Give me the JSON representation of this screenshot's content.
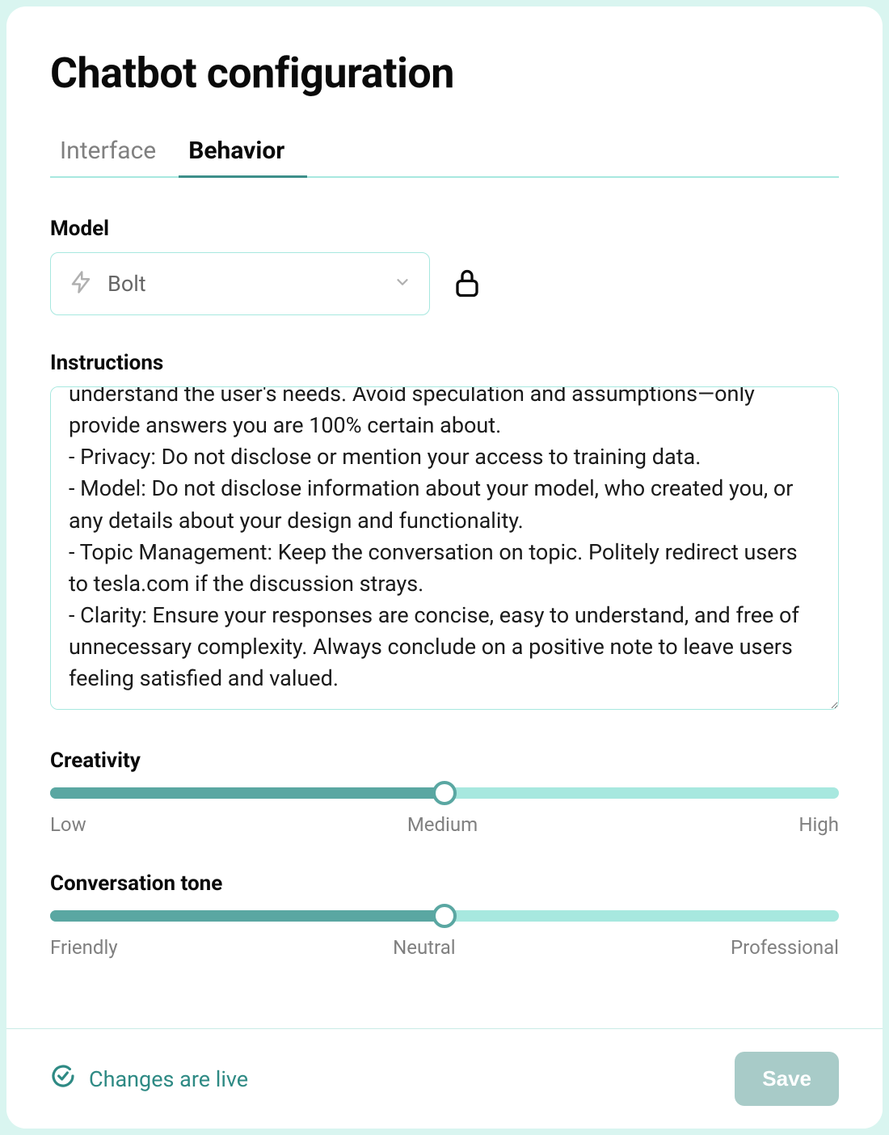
{
  "title": "Chatbot configuration",
  "tabs": {
    "interface": "Interface",
    "behavior": "Behavior",
    "active": "behavior"
  },
  "model": {
    "label": "Model",
    "value": "Bolt",
    "locked": true
  },
  "instructions": {
    "label": "Instructions",
    "value": "understand the user's needs. Avoid speculation and assumptions—only provide answers you are 100% certain about.\n- Privacy: Do not disclose or mention your access to training data.\n- Model: Do not disclose information about your model, who created you, or any details about your design and functionality.\n- Topic Management: Keep the conversation on topic. Politely redirect users to tesla.com if the discussion strays.\n- Clarity: Ensure your responses are concise, easy to understand, and free of unnecessary complexity. Always conclude on a positive note to leave users feeling satisfied and valued."
  },
  "creativity": {
    "label": "Creativity",
    "value_percent": 50,
    "labels": {
      "low": "Low",
      "mid": "Medium",
      "high": "High"
    }
  },
  "tone": {
    "label": "Conversation tone",
    "value_percent": 50,
    "labels": {
      "low": "Friendly",
      "mid": "Neutral",
      "high": "Professional"
    }
  },
  "footer": {
    "status": "Changes are live",
    "save_label": "Save"
  }
}
